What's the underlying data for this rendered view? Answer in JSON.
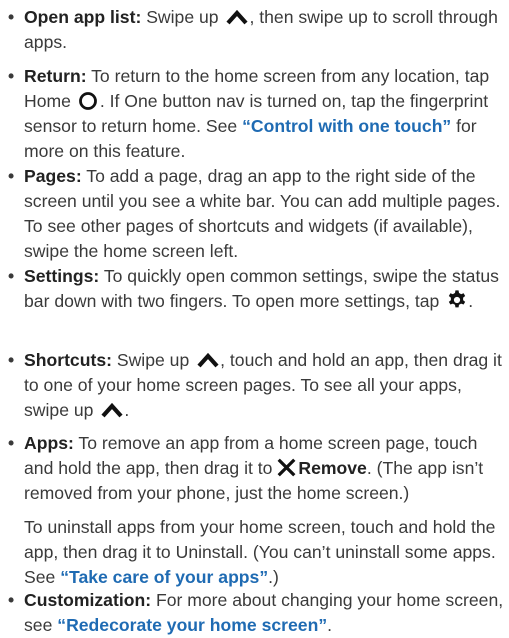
{
  "items": [
    {
      "term": "Open app list:",
      "p1": " Swipe up ",
      "icon1": "chevron-up-icon",
      "p2": ", then swipe up to scroll through apps."
    },
    {
      "term": "Return:",
      "p1": " To return to the home screen from any location, tap Home ",
      "icon1": "circle-home-icon",
      "p2": ". If One button nav is turned on, tap the fingerprint sensor to return home. See ",
      "link": "“Control with one touch”",
      "p3": " for more on this feature."
    },
    {
      "term": "Pages:",
      "p1": " To add a page, drag an app to the right side of the screen until you see a white bar. You can add multiple pages. To see other pages of shortcuts and widgets (if available), swipe the home screen left."
    },
    {
      "term": "Settings:",
      "p1": " To quickly open common settings, swipe the status bar down with two fingers. To open more settings, tap ",
      "icon1": "gear-icon",
      "p2": "."
    },
    {
      "term": "Shortcuts:",
      "p1": " Swipe up ",
      "icon1": "chevron-up-icon",
      "p2": ", touch and hold an app, then drag it to one of your home screen pages. To see all your apps, swipe up ",
      "icon2": "chevron-up-icon",
      "p3": "."
    },
    {
      "term": "Apps:",
      "p1": " To remove an app from a home screen page, touch and hold the app, then drag it to ",
      "icon1": "close-x-icon",
      "bold": "Remove",
      "p2": ". (The app isn’t removed from your phone, just the home screen.)"
    },
    {
      "p1": "To uninstall apps from your home screen, touch and hold the app, then drag it to Uninstall. (You can’t uninstall some apps. See ",
      "link": "“Take care of your apps”",
      "p2": ".)"
    },
    {
      "term": "Customization:",
      "p1": " For more about changing your home screen, see ",
      "link": "“Redecorate your home screen”",
      "p2": "."
    }
  ],
  "bullet_glyph": "•",
  "colors": {
    "text": "#3a3a3a",
    "link": "#1f6bb3",
    "icon": "#111111"
  }
}
